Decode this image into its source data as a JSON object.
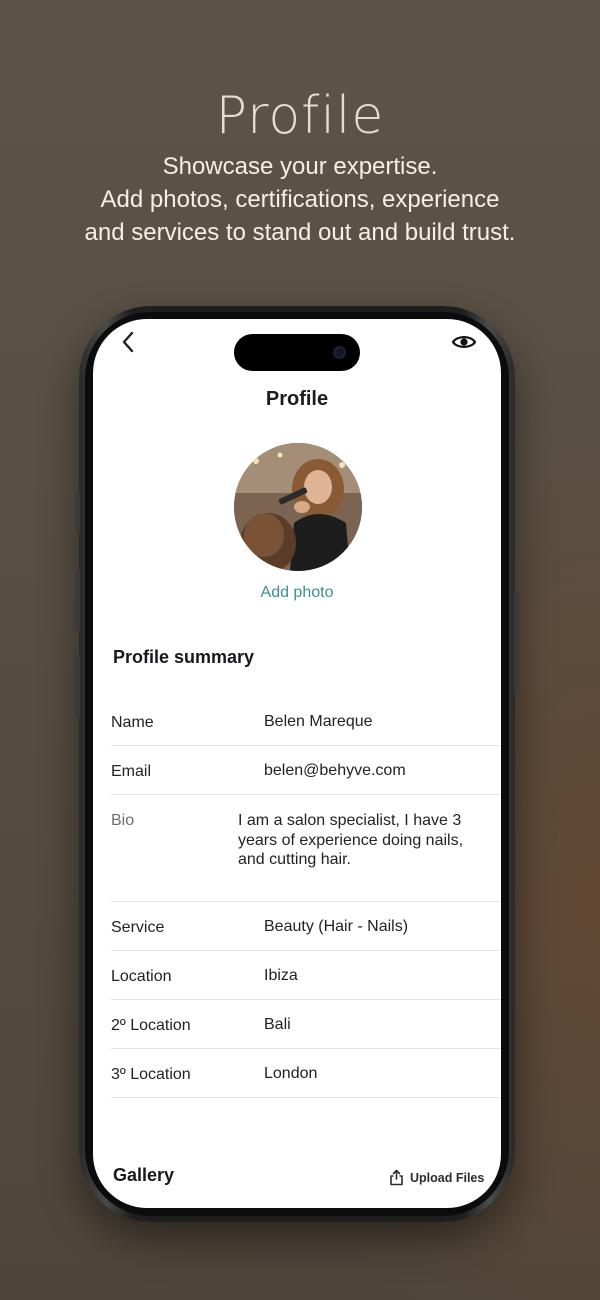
{
  "promo": {
    "title": "Profile",
    "subtitle_lines": [
      "Showcase your expertise.",
      "Add photos, certifications, experience",
      "and services to stand out and build trust."
    ]
  },
  "screen": {
    "title": "Profile",
    "add_photo_label": "Add photo",
    "summary_title": "Profile summary",
    "fields": [
      {
        "label": "Name",
        "value": "Belen Mareque"
      },
      {
        "label": "Email",
        "value": "belen@behyve.com"
      },
      {
        "label": "Bio",
        "value": "I am a salon specialist, I have 3 years of experience doing nails, and cutting hair."
      },
      {
        "label": "Service",
        "value": "Beauty (Hair - Nails)"
      },
      {
        "label": "Location",
        "value": "Ibiza"
      },
      {
        "label": "2º Location",
        "value": "Bali"
      },
      {
        "label": "3º Location",
        "value": "London"
      }
    ],
    "gallery_title": "Gallery",
    "upload_label": "Upload Files"
  },
  "icons": {
    "back": "chevron-left-icon",
    "preview": "eye-icon",
    "upload": "share-upload-icon"
  },
  "colors": {
    "accent": "#3d8f8e",
    "background": "#574e42"
  }
}
